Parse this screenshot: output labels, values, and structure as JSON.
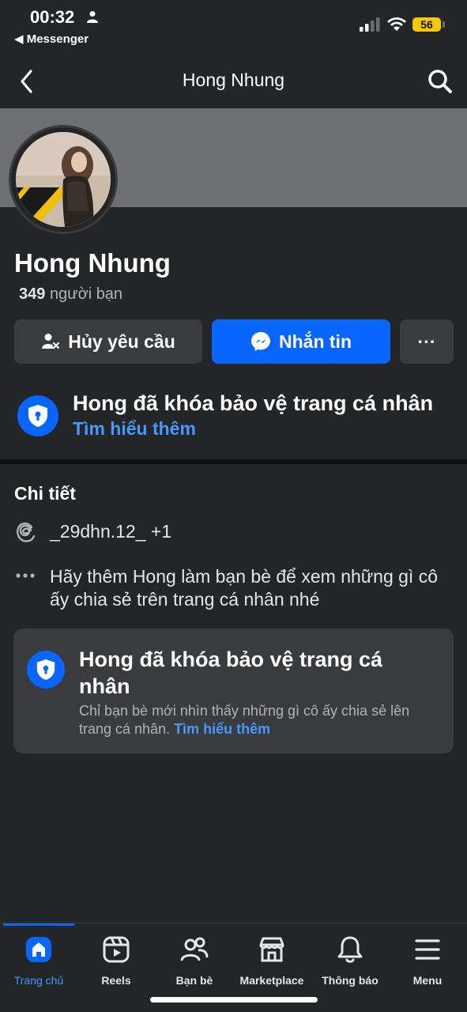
{
  "status": {
    "time": "00:32",
    "back_app": "◀ Messenger",
    "battery": "56"
  },
  "nav": {
    "title": "Hong Nhung"
  },
  "profile": {
    "name": "Hong Nhung",
    "friend_count": "349",
    "friend_label": "người bạn"
  },
  "actions": {
    "cancel_request": "Hủy yêu cầu",
    "message": "Nhắn tin",
    "more": "···"
  },
  "lock_banner": {
    "title": "Hong đã khóa bảo vệ trang cá nhân",
    "link": "Tìm hiểu thêm"
  },
  "details": {
    "title": "Chi tiết",
    "threads_handle": "_29dhn.12_ +1",
    "add_friend_hint": "Hãy thêm Hong làm bạn bè để xem những gì cô ấy chia sẻ trên trang cá nhân nhé"
  },
  "lock_card": {
    "title": "Hong đã khóa bảo vệ trang cá nhân",
    "body": "Chỉ bạn bè mới nhìn thấy những gì cô ấy chia sẻ lên trang cá nhân.",
    "link": "Tìm hiểu thêm"
  },
  "tabs": [
    {
      "label": "Trang chủ",
      "icon": "home-icon",
      "active": true
    },
    {
      "label": "Reels",
      "icon": "reels-icon"
    },
    {
      "label": "Bạn bè",
      "icon": "friends-icon"
    },
    {
      "label": "Marketplace",
      "icon": "marketplace-icon"
    },
    {
      "label": "Thông báo",
      "icon": "bell-icon"
    },
    {
      "label": "Menu",
      "icon": "menu-icon"
    }
  ],
  "colors": {
    "accent": "#0866ff",
    "link": "#4599ff",
    "background": "#242526",
    "surface": "#3a3b3c"
  }
}
